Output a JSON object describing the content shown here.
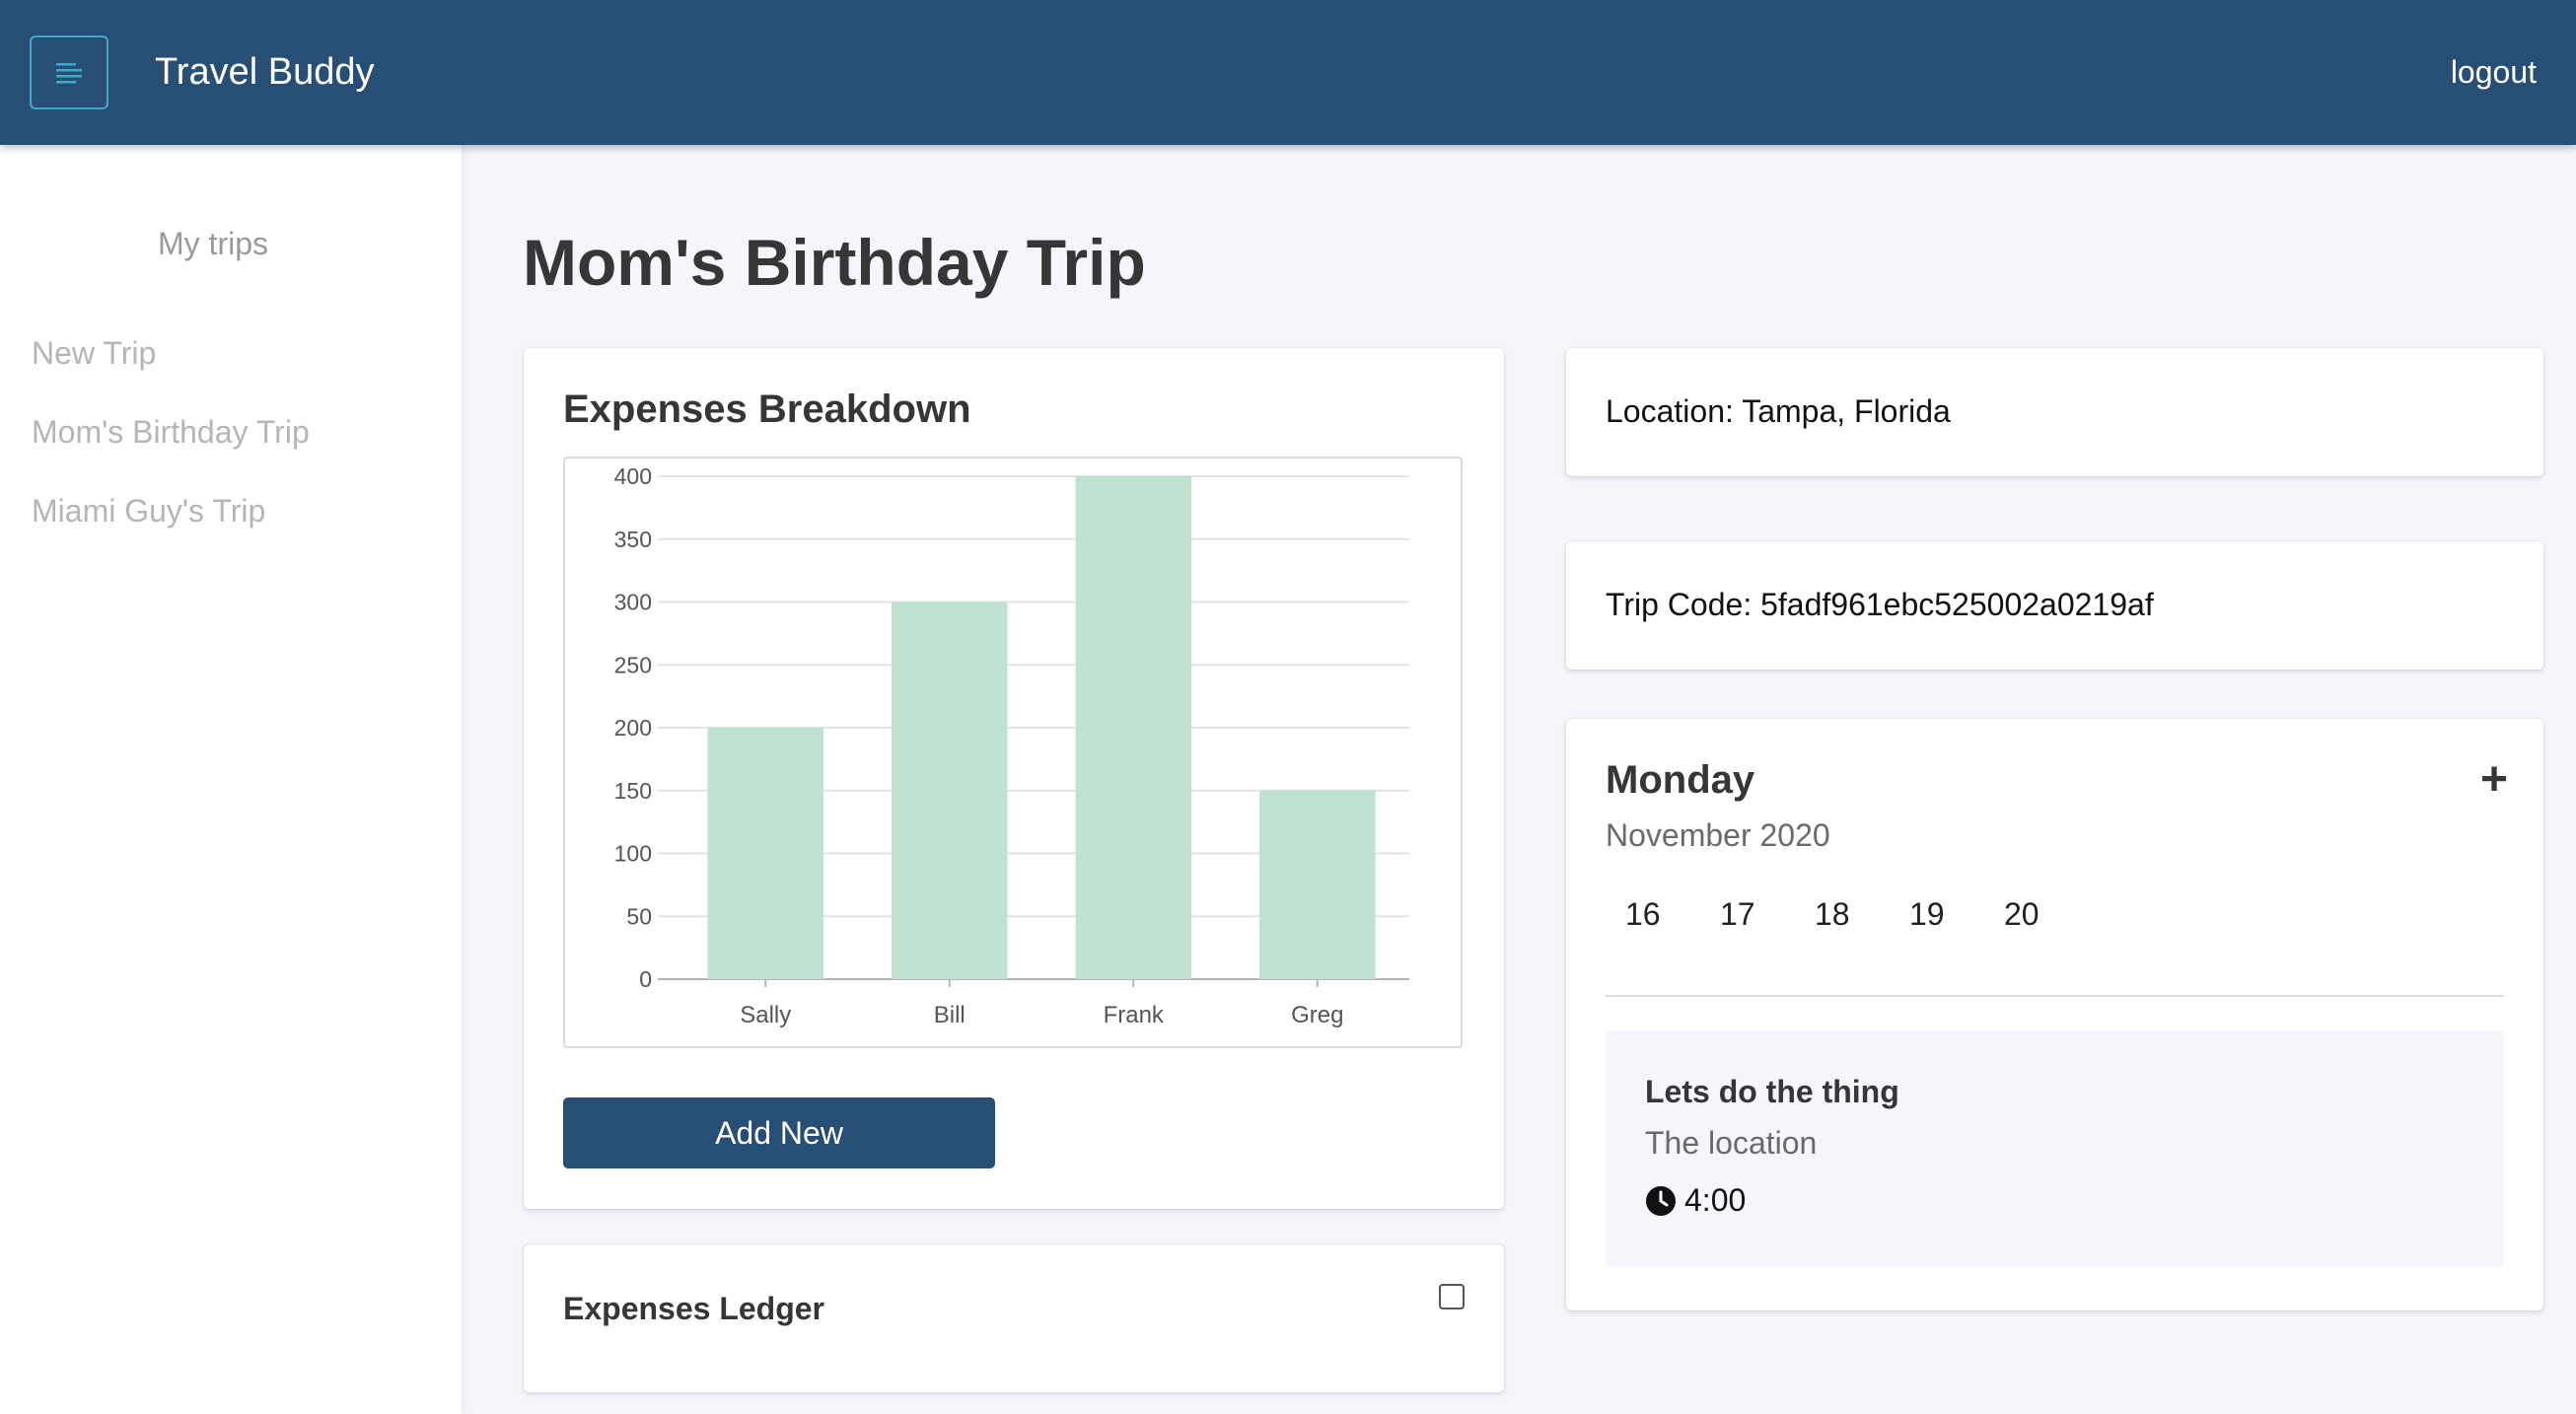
{
  "navbar": {
    "brand": "Travel Buddy",
    "logout": "logout",
    "menu_icon": "menu-icon"
  },
  "sidebar": {
    "heading": "My trips",
    "items": [
      {
        "label": "New Trip"
      },
      {
        "label": "Mom's Birthday Trip"
      },
      {
        "label": "Miami Guy's Trip"
      }
    ]
  },
  "page": {
    "title": "Mom's Birthday Trip"
  },
  "expenses": {
    "title": "Expenses Breakdown",
    "add_label": "Add New",
    "ledger_title": "Expenses Ledger"
  },
  "chart_data": {
    "type": "bar",
    "categories": [
      "Sally",
      "Bill",
      "Frank",
      "Greg"
    ],
    "values": [
      200,
      300,
      400,
      150
    ],
    "yticks": [
      0,
      50,
      100,
      150,
      200,
      250,
      300,
      350,
      400
    ],
    "ylim": [
      0,
      400
    ],
    "grid": true,
    "bar_color": "#bfe1cf"
  },
  "trip_info": {
    "location": "Location: Tampa, Florida",
    "code": "Trip Code: 5fadf961ebc525002a0219af"
  },
  "calendar": {
    "day": "Monday",
    "month_year": "November 2020",
    "dates": [
      "16",
      "17",
      "18",
      "19",
      "20"
    ],
    "event": {
      "title": "Lets do the thing",
      "location": "The location",
      "time": "4:00"
    }
  },
  "colors": {
    "primary": "#274e74",
    "accent": "#3fa9c9",
    "background": "#f5f5fb"
  }
}
